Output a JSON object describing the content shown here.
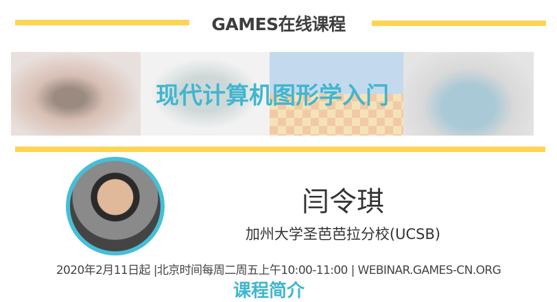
{
  "header": {
    "title": "GAMES在线课程"
  },
  "banner": {
    "course_title": "现代计算机图形学入门"
  },
  "speaker": {
    "name": "闫令琪",
    "affiliation": "加州大学圣芭芭拉分校(UCSB)"
  },
  "schedule": "2020年2月11日起 |北京时间每周二周五上午10:00-11:00 | WEBINAR.GAMES-CN.ORG",
  "next_section": "课程简介",
  "colors": {
    "accent_yellow": "#fed451",
    "accent_teal": "#40b6cf"
  }
}
